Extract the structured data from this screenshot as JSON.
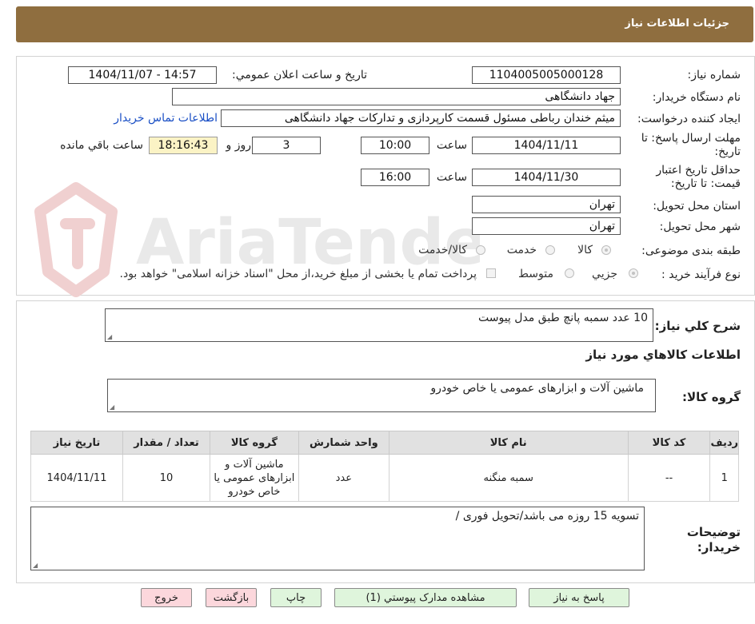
{
  "header": {
    "title": "جزئیات اطلاعات نیاز"
  },
  "form": {
    "need_number_label": "شماره نیاز:",
    "need_number": "1104005005000128",
    "announce_label": "تاریخ و ساعت اعلان عمومي:",
    "announce_value": "1404/11/07 - 14:57",
    "buyer_org_label": "نام دستگاه خريدار:",
    "buyer_org": "جهاد دانشگاهی",
    "requester_label": "ايجاد کننده درخواست:",
    "requester": "میثم خندان رباطی مسئول قسمت کارپردازی و تدارکات جهاد دانشگاهی",
    "contact_link": "اطلاعات تماس خريدار",
    "deadline_label": "مهلت ارسال پاسخ: تا تاريخ:",
    "deadline_date": "1404/11/11",
    "time_label": "ساعت",
    "deadline_time": "10:00",
    "days_value": "3",
    "days_word": "روز و",
    "remaining_time": "18:16:43",
    "remaining_label": "ساعت باقي مانده",
    "validity_label": "حداقل تاريخ اعتبار قيمت: تا تاريخ:",
    "validity_date": "1404/11/30",
    "validity_time": "16:00",
    "province_label": "استان محل تحويل:",
    "province": "تهران",
    "city_label": "شهر محل تحويل:",
    "city": "تهران",
    "category_label": "طبقه بندی موضوعی:",
    "category_options": [
      "کالا",
      "خدمت",
      "کالا/خدمت"
    ],
    "process_label": "نوع فرآيند خريد :",
    "process_options": [
      "جزيي",
      "متوسط"
    ],
    "process_note": "پرداخت تمام يا بخشی از مبلغ خريد،از محل \"اسناد خزانه اسلامی\" خواهد بود."
  },
  "details": {
    "general_desc_label": "شرح کلي نياز:",
    "general_desc": "10 عدد سمبه پانچ طبق مدل پیوست",
    "goods_info_title": "اطلاعات کالاهاي مورد نياز",
    "goods_group_label": "گروه کالا:",
    "goods_group": "ماشین آلات و ابزارهای عمومی یا خاص خودرو",
    "table": {
      "headers": [
        "رديف",
        "کد کالا",
        "نام کالا",
        "واحد شمارش",
        "گروه کالا",
        "تعداد / مقدار",
        "تاريخ نياز"
      ],
      "rows": [
        [
          "1",
          "--",
          "سمبه منگنه",
          "عدد",
          "ماشین آلات و ابزارهای عمومی یا خاص خودرو",
          "10",
          "1404/11/11"
        ]
      ]
    },
    "buyer_notes_label": "توضيحات خريدار:",
    "buyer_notes": "تسویه 15 روزه می باشد/تحویل فوری /"
  },
  "buttons": {
    "reply": "پاسخ به نياز",
    "view_docs": "مشاهده مدارک پيوستي (1)",
    "print": "چاپ",
    "back": "بازگشت",
    "exit": "خروج"
  },
  "colors": {
    "header_bg": "#8f6e3f",
    "link": "#1a4fc5",
    "timer_bg": "#fbf3c5",
    "green_button": "#dff5dc",
    "pink_button": "#fcd7dc"
  }
}
